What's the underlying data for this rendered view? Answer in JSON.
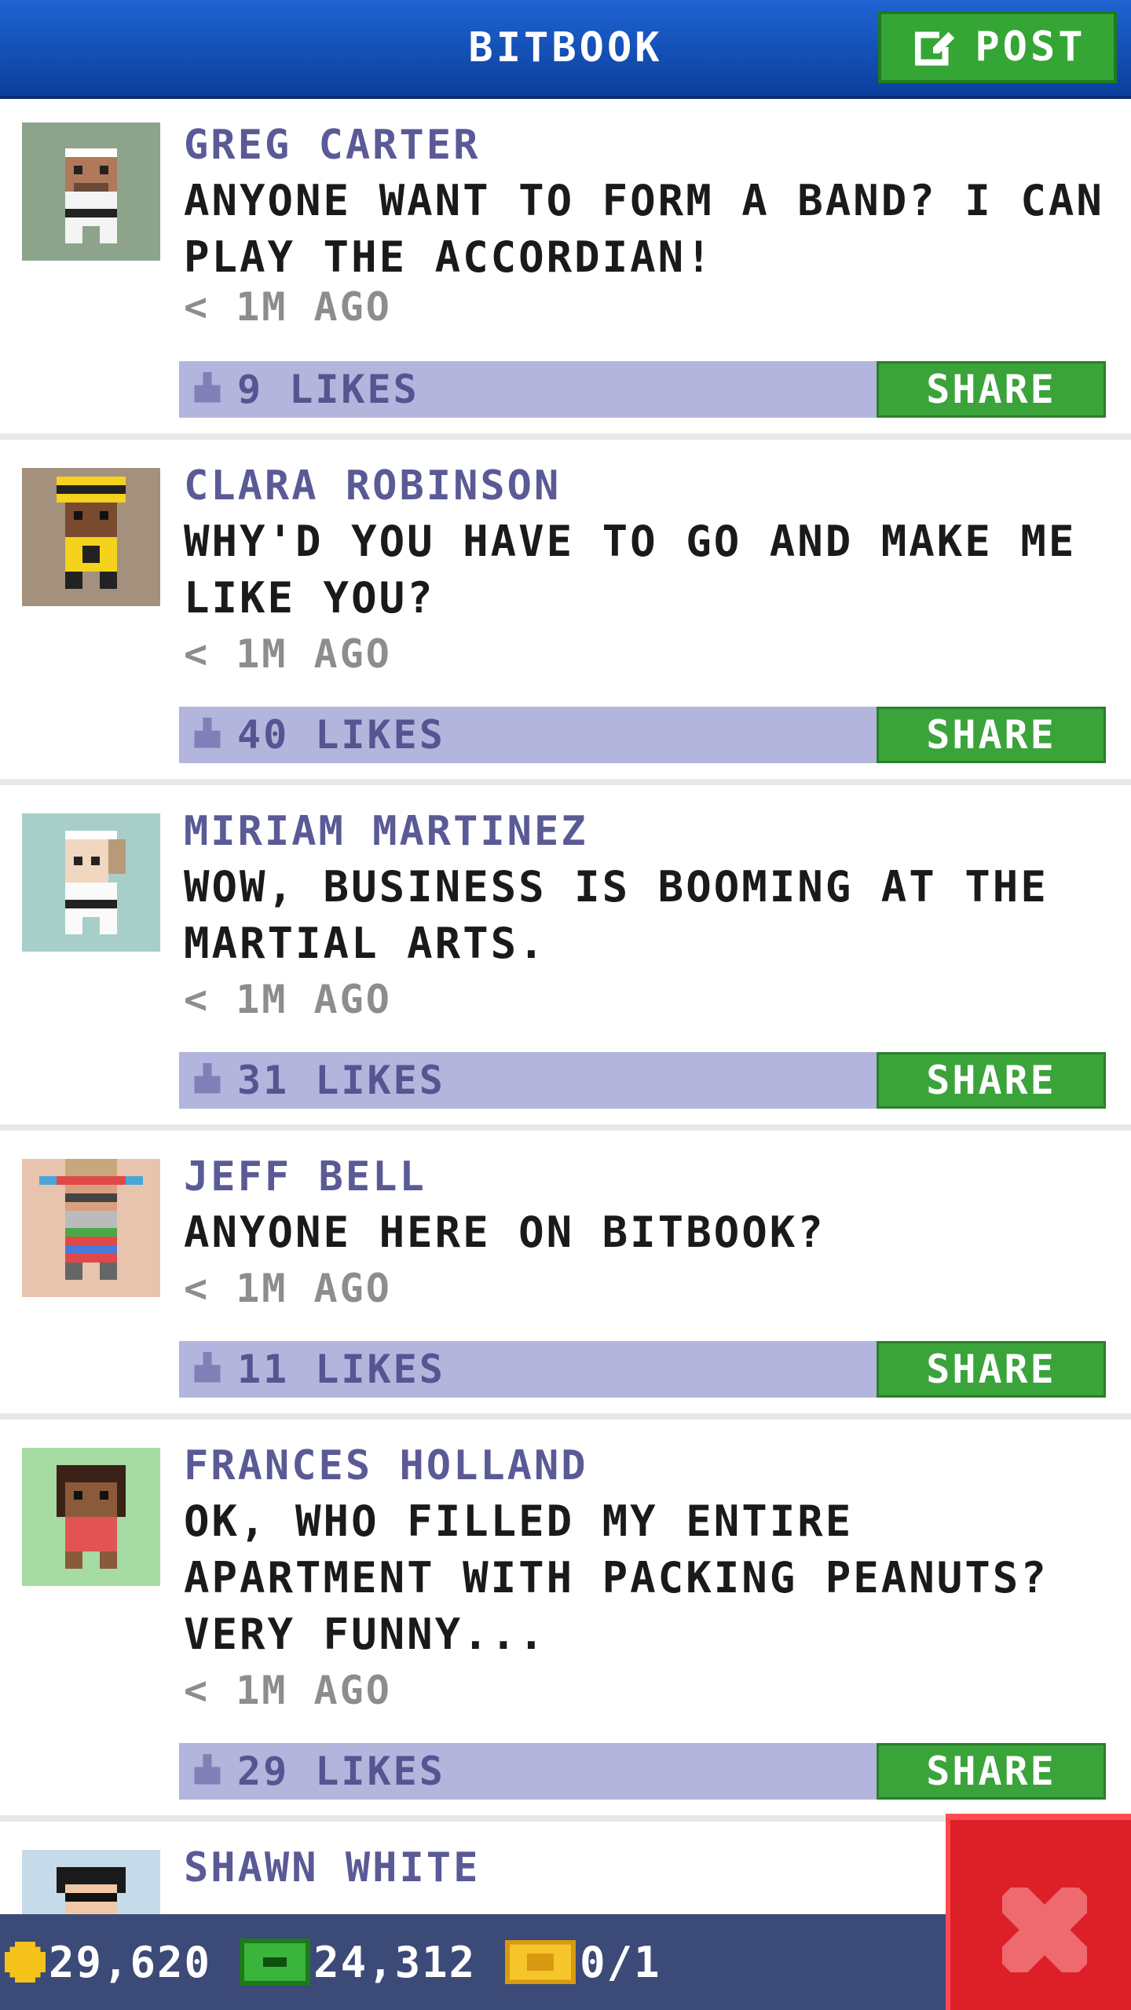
{
  "header": {
    "title": "BITBOOK",
    "post_label": "POST"
  },
  "posts": [
    {
      "author": "GREG CARTER",
      "message": "ANYONE WANT TO FORM A BAND? I CAN PLAY THE ACCORDIAN!",
      "time": "< 1M AGO",
      "likes": "9 LIKES",
      "share_label": "SHARE",
      "avatar_bg": "#8da38b",
      "avatar_icon": "karate-guy-avatar"
    },
    {
      "author": "CLARA ROBINSON",
      "message": "WHY'D YOU HAVE TO GO AND MAKE ME LIKE YOU?",
      "time": "< 1M AGO",
      "likes": "40 LIKES",
      "share_label": "SHARE",
      "avatar_bg": "#a3917e",
      "avatar_icon": "yellow-hat-avatar"
    },
    {
      "author": "MIRIAM MARTINEZ",
      "message": "WOW, BUSINESS IS BOOMING AT THE MARTIAL ARTS.",
      "time": "< 1M AGO",
      "likes": "31 LIKES",
      "share_label": "SHARE",
      "avatar_bg": "#a8cec9",
      "avatar_icon": "martial-arts-avatar"
    },
    {
      "author": "JEFF BELL",
      "message": "ANYONE HERE ON BITBOOK?",
      "time": "< 1M AGO",
      "likes": "11 LIKES",
      "share_label": "SHARE",
      "avatar_bg": "#e8c4ae",
      "avatar_icon": "sombrero-avatar"
    },
    {
      "author": "FRANCES HOLLAND",
      "message": "OK, WHO FILLED MY ENTIRE APARTMENT WITH PACKING PEANUTS? VERY FUNNY...",
      "time": "< 1M AGO",
      "likes": "29 LIKES",
      "share_label": "SHARE",
      "avatar_bg": "#a6dba3",
      "avatar_icon": "red-shirt-avatar"
    },
    {
      "author": "SHAWN WHITE",
      "avatar_bg": "#c6dbe9",
      "avatar_icon": "sunglasses-avatar"
    }
  ],
  "bottom_bar": {
    "coins": "29,620",
    "bux": "24,312",
    "vip": "0/1"
  },
  "colors": {
    "header_blue": "#0b3f9c",
    "share_green": "#3aa33a",
    "likes_bar": "#b3b5dc",
    "author_purple": "#5a5a96",
    "close_red": "#dd1f28"
  }
}
